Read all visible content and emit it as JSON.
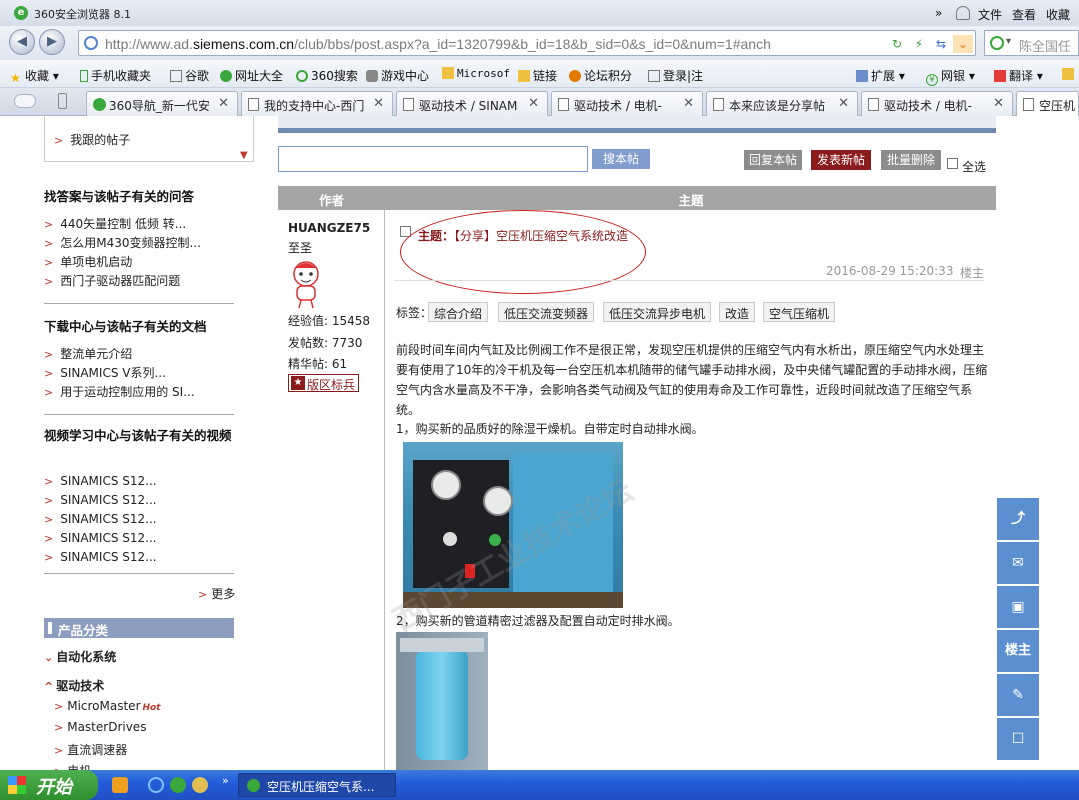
{
  "browser": {
    "title": "360安全浏览器 8.1",
    "chevrons": "»",
    "menu": [
      "文件",
      "查看",
      "收藏"
    ],
    "url_prefix": "http://www.ad.",
    "url_domain": "siemens.com.cn",
    "url_suffix": "/club/bbs/post.aspx?a_id=1320799&b_id=18&b_sid=0&s_id=0&num=1#anch",
    "search_placeholder": "陈全国任"
  },
  "favorites": [
    "收藏",
    "手机收藏夹",
    "谷歌",
    "网址大全",
    "360搜索",
    "游戏中心",
    "Microsof",
    "链接",
    "论坛积分",
    "登录|注",
    "扩展",
    "网银",
    "翻译"
  ],
  "tabs": [
    {
      "label": "360导航_新一代安"
    },
    {
      "label": "我的支持中心-西门"
    },
    {
      "label": "驱动技术 / SINAM"
    },
    {
      "label": "驱动技术 / 电机-"
    },
    {
      "label": "本来应该是分享帖"
    },
    {
      "label": "驱动技术 / 电机-"
    },
    {
      "label": "空压机"
    }
  ],
  "sidebar": {
    "top_links": [
      "我跟的帖子"
    ],
    "section1_title": "找答案与该帖子有关的问答",
    "section1_items": [
      "440矢量控制 低频 转...",
      "怎么用M430变频器控制...",
      "单项电机启动",
      "西门子驱动器匹配问题"
    ],
    "section2_title": "下载中心与该帖子有关的文档",
    "section2_items": [
      "整流单元介绍",
      "SINAMICS V系列...",
      "用于运动控制应用的 SI..."
    ],
    "section3_title": "视频学习中心与该帖子有关的视频",
    "section3_items": [
      "SINAMICS S12...",
      "SINAMICS S12...",
      "SINAMICS S12...",
      "SINAMICS S12...",
      "SINAMICS S12..."
    ],
    "more": "更多",
    "product_title": "产品分类",
    "cat_automation": "自动化系统",
    "cat_drive": "驱动技术",
    "drive_items": [
      "MicroMaster",
      "MasterDrives",
      "直流调速器",
      "电机"
    ],
    "hot_badge": "Hot"
  },
  "main": {
    "search_button": "搜本帖",
    "reply_button": "回复本帖",
    "new_post_button": "发表新帖",
    "batch_delete_button": "批量删除",
    "select_all": "全选",
    "col_author": "作者",
    "col_subject": "主题",
    "author": {
      "name": "HUANGZE75",
      "rank": "至圣",
      "exp_label": "经验值: 15458",
      "posts_label": "发帖数: 7730",
      "essence_label": "精华帖: 61",
      "badge": "版区标兵"
    },
    "subject_prefix": "主题：",
    "subject_title": "【分享】空压机压缩空气系统改造",
    "date": "2016-08-29 15:20:33",
    "floor": "楼主",
    "tags_label": "标签：",
    "tags": [
      "综合介绍",
      "低压交流变频器",
      "低压交流异步电机",
      "改造",
      "空气压缩机"
    ],
    "paragraph": "前段时间车间内气缸及比例阀工作不是很正常，发现空压机提供的压缩空气内有水析出，原压缩空气内水处理主要有使用了10年的冷干机及每一台空压机本机随带的储气罐手动排水阀，及中央储气罐配置的手动排水阀，压缩空气内含水量高及不干净，会影响各类气动阀及气缸的使用寿命及工作可靠性，近段时间就改造了压缩空气系统。",
    "step1": "1，购买新的品质好的除湿干燥机。自带定时自动排水阀。",
    "step2": "2，购买新的管道精密过滤器及配置自动定时排水阀。",
    "watermark": "西门子工业技术论坛"
  },
  "floatbar": [
    "share-icon",
    "mail-icon",
    "qrcode-icon",
    "楼主",
    "edit-icon",
    "chat-icon"
  ],
  "floor_owner": "楼主",
  "taskbar": {
    "start": "开始",
    "chevrons": "»",
    "active_task": "空压机压缩空气系..."
  }
}
